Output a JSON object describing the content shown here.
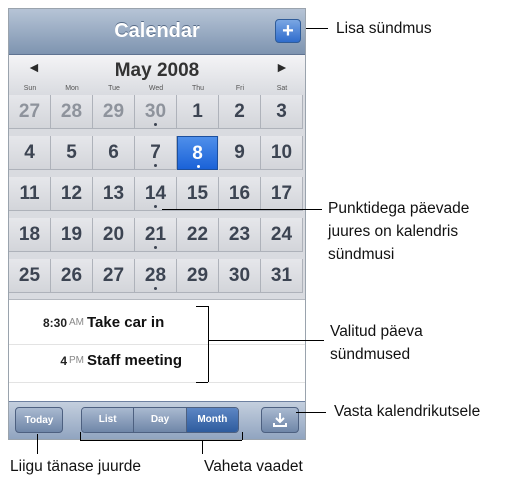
{
  "app": {
    "title": "Calendar",
    "add_button": "+"
  },
  "month": {
    "label": "May 2008",
    "prev_icon": "◄",
    "next_icon": "►"
  },
  "weekdays": [
    "Sun",
    "Mon",
    "Tue",
    "Wed",
    "Thu",
    "Fri",
    "Sat"
  ],
  "days": [
    {
      "d": "27",
      "muted": true,
      "dot": false
    },
    {
      "d": "28",
      "muted": true,
      "dot": false
    },
    {
      "d": "29",
      "muted": true,
      "dot": false
    },
    {
      "d": "30",
      "muted": true,
      "dot": true
    },
    {
      "d": "1",
      "muted": false,
      "dot": false
    },
    {
      "d": "2",
      "muted": false,
      "dot": false
    },
    {
      "d": "3",
      "muted": false,
      "dot": false
    },
    {
      "d": "4",
      "muted": false,
      "dot": false
    },
    {
      "d": "5",
      "muted": false,
      "dot": false
    },
    {
      "d": "6",
      "muted": false,
      "dot": false
    },
    {
      "d": "7",
      "muted": false,
      "dot": true
    },
    {
      "d": "8",
      "muted": false,
      "dot": true,
      "selected": true
    },
    {
      "d": "9",
      "muted": false,
      "dot": false
    },
    {
      "d": "10",
      "muted": false,
      "dot": false
    },
    {
      "d": "11",
      "muted": false,
      "dot": false
    },
    {
      "d": "12",
      "muted": false,
      "dot": false
    },
    {
      "d": "13",
      "muted": false,
      "dot": false
    },
    {
      "d": "14",
      "muted": false,
      "dot": true
    },
    {
      "d": "15",
      "muted": false,
      "dot": false
    },
    {
      "d": "16",
      "muted": false,
      "dot": false
    },
    {
      "d": "17",
      "muted": false,
      "dot": false
    },
    {
      "d": "18",
      "muted": false,
      "dot": false
    },
    {
      "d": "19",
      "muted": false,
      "dot": false
    },
    {
      "d": "20",
      "muted": false,
      "dot": false
    },
    {
      "d": "21",
      "muted": false,
      "dot": true
    },
    {
      "d": "22",
      "muted": false,
      "dot": false
    },
    {
      "d": "23",
      "muted": false,
      "dot": false
    },
    {
      "d": "24",
      "muted": false,
      "dot": false
    },
    {
      "d": "25",
      "muted": false,
      "dot": false
    },
    {
      "d": "26",
      "muted": false,
      "dot": false
    },
    {
      "d": "27",
      "muted": false,
      "dot": false
    },
    {
      "d": "28",
      "muted": false,
      "dot": true
    },
    {
      "d": "29",
      "muted": false,
      "dot": false
    },
    {
      "d": "30",
      "muted": false,
      "dot": false
    },
    {
      "d": "31",
      "muted": false,
      "dot": false
    }
  ],
  "events": [
    {
      "time": "8:30",
      "ampm": "AM",
      "title": "Take car in"
    },
    {
      "time": "4",
      "ampm": "PM",
      "title": "Staff meeting"
    }
  ],
  "toolbar": {
    "today": "Today",
    "views": [
      "List",
      "Day",
      "Month"
    ],
    "active_view": "Month",
    "sync_icon": "download-icon"
  },
  "callouts": {
    "add_event": "Lisa sündmus",
    "dots_line1": "Punktidega päevade",
    "dots_line2": "juures on kalendris",
    "dots_line3": "sündmusi",
    "selected_line1": "Valitud päeva",
    "selected_line2": "sündmused",
    "sync": "Vasta kalendrikutsele",
    "today": "Liigu tänase juurde",
    "switch": "Vaheta vaadet"
  },
  "colors": {
    "selected": "#1a62d8",
    "title_bar": "#8a9fba"
  }
}
